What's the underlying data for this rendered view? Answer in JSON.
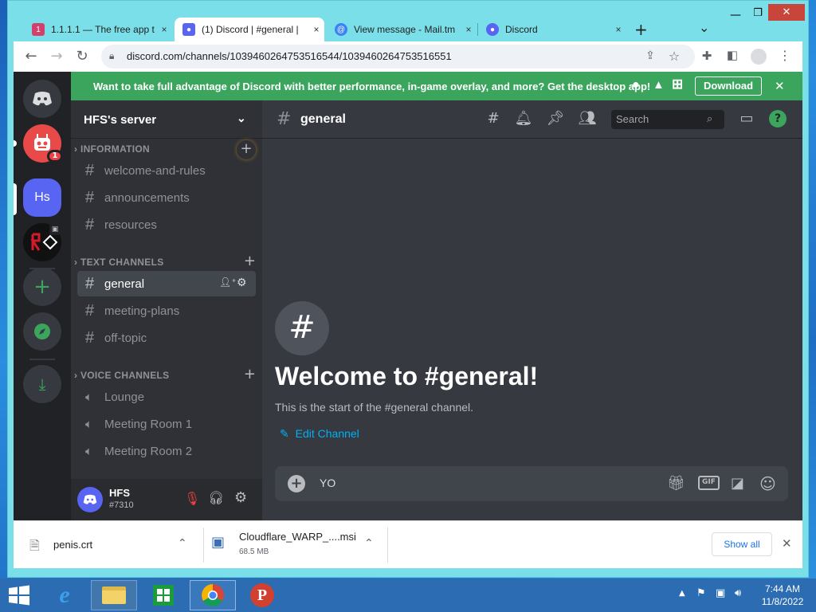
{
  "browser": {
    "tabs": [
      {
        "title": "1.1.1.1 — The free app t",
        "close": "×"
      },
      {
        "title": "(1) Discord | #general | ",
        "close": "×"
      },
      {
        "title": "View message - Mail.tm",
        "close": "×"
      },
      {
        "title": "Discord",
        "close": "×"
      }
    ],
    "new_tab": "+",
    "tab_menu": "⌄",
    "url": "discord.com/channels/1039460264753516544/1039460264753516551"
  },
  "banner": {
    "text": "Want to take full advantage of Discord with better performance, in-game overlay, and more? Get the desktop app!",
    "download_label": "Download",
    "close": "✕"
  },
  "server": {
    "name": "HFS's server",
    "guild_badge": "1",
    "active_guild_initials": "Hs"
  },
  "categories": [
    {
      "name": "INFORMATION",
      "channels": [
        "welcome-and-rules",
        "announcements",
        "resources"
      ]
    },
    {
      "name": "TEXT CHANNELS",
      "channels": [
        "general",
        "meeting-plans",
        "off-topic"
      ]
    },
    {
      "name": "VOICE CHANNELS",
      "channels": [
        "Lounge",
        "Meeting Room 1",
        "Meeting Room 2"
      ]
    }
  ],
  "channel": {
    "name": "general",
    "search_placeholder": "Search",
    "welcome_title": "Welcome to #general!",
    "welcome_sub": "This is the start of the #general channel.",
    "edit_label": "Edit Channel",
    "composer_text": "YO"
  },
  "user": {
    "name": "HFS",
    "tag": "#7310"
  },
  "downloads": {
    "items": [
      {
        "name": "penis.crt",
        "size": ""
      },
      {
        "name": "Cloudflare_WARP_....msi",
        "size": "68.5 MB"
      }
    ],
    "show_all": "Show all",
    "close": "✕"
  },
  "taskbar": {
    "time": "7:44 AM",
    "date": "11/8/2022"
  },
  "colors": {
    "discord_blurple": "#5865f2",
    "banner_green": "#3ba55d",
    "bg": "#36393f"
  }
}
